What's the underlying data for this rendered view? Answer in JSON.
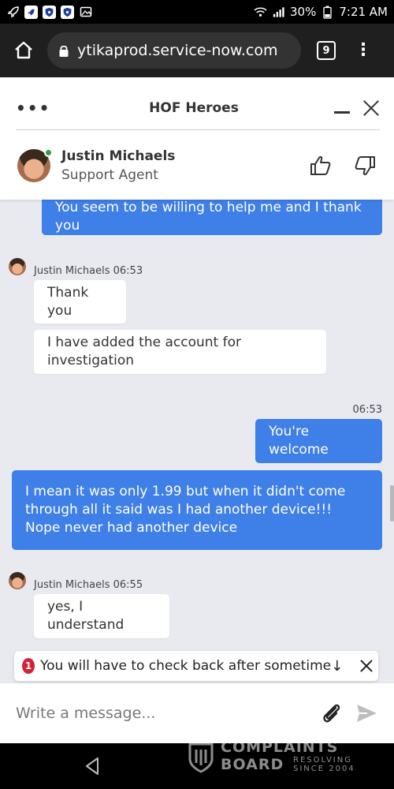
{
  "status_bar": {
    "battery": "30%",
    "time": "7:21 AM"
  },
  "browser": {
    "url": "ytikaprod.service-now.com",
    "tab_count": "9"
  },
  "chat": {
    "title": "HOF Heroes",
    "agent": {
      "name": "Justin Michaels",
      "role": "Support Agent",
      "status": "online"
    },
    "messages": [
      {
        "direction": "out",
        "text": "You seem to be willing to help me and I thank you"
      },
      {
        "direction": "meta",
        "text": "Justin Michaels 06:53"
      },
      {
        "direction": "in",
        "text": "Thank you"
      },
      {
        "direction": "in",
        "text": "I have added the account for investigation"
      },
      {
        "direction": "meta",
        "text": "06:53"
      },
      {
        "direction": "out",
        "text": "You're welcome"
      },
      {
        "direction": "out",
        "text": "I mean it was only 1.99 but when it didn't come through all it said was I had another device!!! Nope never had another device"
      },
      {
        "direction": "meta",
        "text": "Justin Michaels 06:55"
      },
      {
        "direction": "in",
        "text": "yes, I understand"
      }
    ],
    "notification": {
      "count": "1",
      "text": "You will have to check back after sometime"
    },
    "composer": {
      "placeholder": "Write a message..."
    }
  },
  "watermark": {
    "line1": "COMPLAINTS",
    "line2": "BOARD",
    "tagline": "RESOLVING SINCE 2004"
  },
  "colors": {
    "outgoing_bubble": "#3f7fe8",
    "chat_background": "#e8eaf0",
    "notification_badge": "#d2223a",
    "online": "#2e9e4a"
  }
}
